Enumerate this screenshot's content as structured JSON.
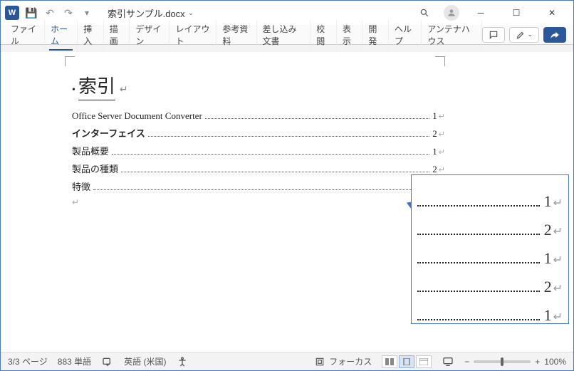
{
  "titlebar": {
    "app_letter": "W",
    "doc_name": "索引サンプル.docx"
  },
  "ribbon": {
    "tabs": [
      "ファイル",
      "ホーム",
      "挿入",
      "描画",
      "デザイン",
      "レイアウト",
      "参考資料",
      "差し込み文書",
      "校閲",
      "表示",
      "開発",
      "ヘルプ",
      "アンテナハウス"
    ],
    "active_index": 1
  },
  "document": {
    "heading": "索引",
    "entries": [
      {
        "label": "Office Server Document Converter",
        "page": "1",
        "bold": false
      },
      {
        "label": "インターフェイス",
        "page": "2",
        "bold": true
      },
      {
        "label": "製品概要",
        "page": "1",
        "bold": false
      },
      {
        "label": "製品の種類",
        "page": "2",
        "bold": false
      },
      {
        "label": "特徴",
        "page": "1",
        "bold": false
      }
    ]
  },
  "callout_pages": [
    "1",
    "2",
    "1",
    "2",
    "1"
  ],
  "statusbar": {
    "page": "3/3 ページ",
    "words": "883 単語",
    "lang": "英語 (米国)",
    "focus": "フォーカス",
    "zoom": "100%"
  }
}
